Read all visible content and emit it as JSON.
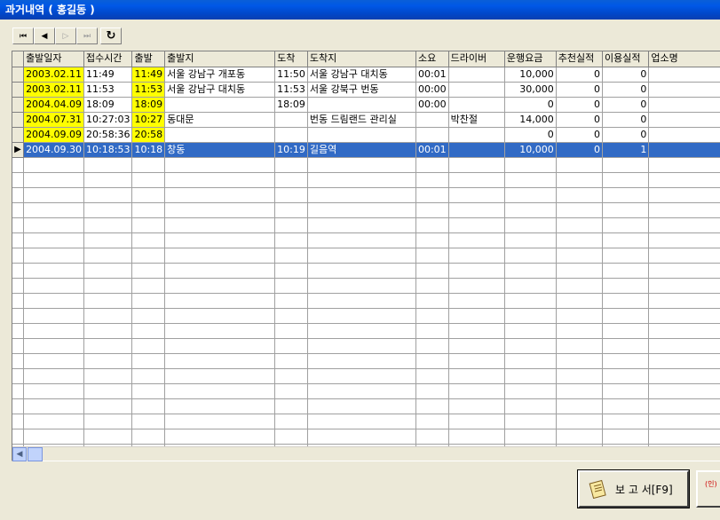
{
  "window": {
    "title": "과거내역 ( 홍길동 )"
  },
  "nav": {
    "first": "⏮",
    "prev": "◀",
    "next": "▷",
    "last": "⏭",
    "refresh": "↻"
  },
  "grid": {
    "columns": [
      "출발일자",
      "접수시간",
      "출발",
      "출발지",
      "도착",
      "도착지",
      "소요",
      "드라이버",
      "운행요금",
      "추천실적",
      "이용실적",
      "업소명"
    ],
    "rows": [
      [
        "2003.02.11",
        "11:49",
        "11:49",
        "서울 강남구 개포동",
        "11:50",
        "서울 강남구 대치동",
        "00:01",
        "",
        "10,000",
        "0",
        "0",
        ""
      ],
      [
        "2003.02.11",
        "11:53",
        "11:53",
        "서울 강남구 대치동",
        "11:53",
        "서울 강북구 번동",
        "00:00",
        "",
        "30,000",
        "0",
        "0",
        ""
      ],
      [
        "2004.04.09",
        "18:09",
        "18:09",
        "",
        "18:09",
        "",
        "00:00",
        "",
        "0",
        "0",
        "0",
        ""
      ],
      [
        "2004.07.31",
        "10:27:03",
        "10:27",
        "동대문",
        "",
        "번동 드림랜드 관리실",
        "",
        "박찬절",
        "14,000",
        "0",
        "0",
        ""
      ],
      [
        "2004.09.09",
        "20:58:36",
        "20:58",
        "",
        "",
        "",
        "",
        "",
        "0",
        "0",
        "0",
        ""
      ],
      [
        "2004.09.30",
        "10:18:53",
        "10:18",
        "창동",
        "10:19",
        "길음역",
        "00:01",
        "",
        "10,000",
        "0",
        "1",
        ""
      ]
    ],
    "selected_row": 5,
    "current_marker": "▶"
  },
  "buttons": {
    "report_label": "보 고 서[F9]",
    "second_label": "(인)"
  },
  "colors": {
    "highlight": "#ffff00",
    "selection": "#316ac5"
  }
}
